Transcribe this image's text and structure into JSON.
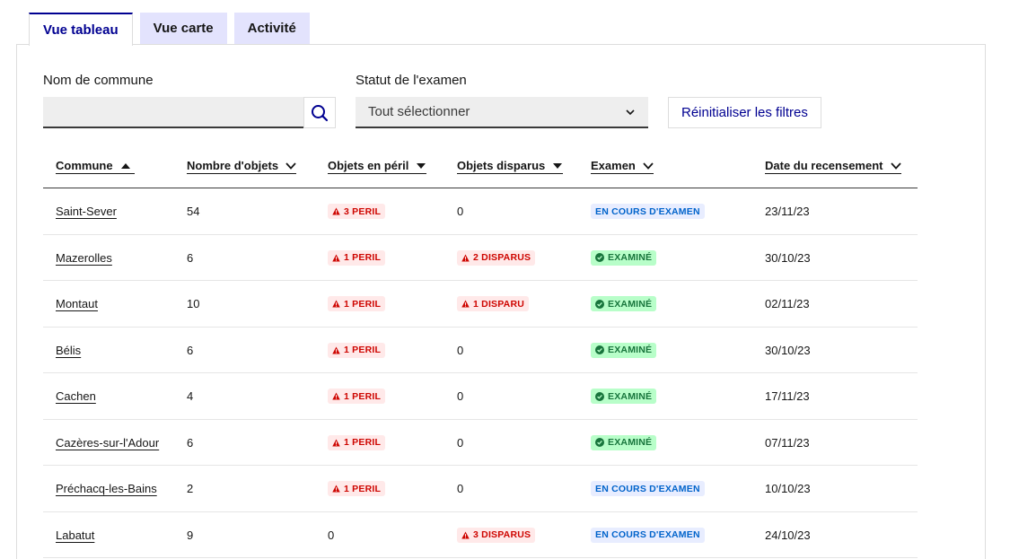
{
  "tabs": [
    {
      "label": "Vue tableau",
      "active": true
    },
    {
      "label": "Vue carte",
      "active": false
    },
    {
      "label": "Activité",
      "active": false
    }
  ],
  "filters": {
    "commune_label": "Nom de commune",
    "commune_value": "",
    "statut_label": "Statut de l'examen",
    "statut_value": "Tout sélectionner",
    "reset_label": "Réinitialiser les filtres"
  },
  "table": {
    "columns": [
      {
        "label": "Commune",
        "sort": "asc"
      },
      {
        "label": "Nombre d'objets",
        "sort": "none"
      },
      {
        "label": "Objets en péril",
        "sort": "desc"
      },
      {
        "label": "Objets disparus",
        "sort": "desc"
      },
      {
        "label": "Examen",
        "sort": "none"
      },
      {
        "label": "Date du recensement",
        "sort": "none"
      }
    ],
    "rows": [
      {
        "commune": "Saint-Sever",
        "objets": "54",
        "peril": {
          "text": "3 PERIL",
          "badge": true
        },
        "disparus": {
          "text": "0",
          "badge": false
        },
        "examen": {
          "text": "EN COURS D'EXAMEN",
          "status": "pending"
        },
        "date": "23/11/23"
      },
      {
        "commune": "Mazerolles",
        "objets": "6",
        "peril": {
          "text": "1 PERIL",
          "badge": true
        },
        "disparus": {
          "text": "2 DISPARUS",
          "badge": true
        },
        "examen": {
          "text": "EXAMINÉ",
          "status": "done"
        },
        "date": "30/10/23"
      },
      {
        "commune": "Montaut",
        "objets": "10",
        "peril": {
          "text": "1 PERIL",
          "badge": true
        },
        "disparus": {
          "text": "1 DISPARU",
          "badge": true
        },
        "examen": {
          "text": "EXAMINÉ",
          "status": "done"
        },
        "date": "02/11/23"
      },
      {
        "commune": "Bélis",
        "objets": "6",
        "peril": {
          "text": "1 PERIL",
          "badge": true
        },
        "disparus": {
          "text": "0",
          "badge": false
        },
        "examen": {
          "text": "EXAMINÉ",
          "status": "done"
        },
        "date": "30/10/23"
      },
      {
        "commune": "Cachen",
        "objets": "4",
        "peril": {
          "text": "1 PERIL",
          "badge": true
        },
        "disparus": {
          "text": "0",
          "badge": false
        },
        "examen": {
          "text": "EXAMINÉ",
          "status": "done"
        },
        "date": "17/11/23"
      },
      {
        "commune": "Cazères-sur-l'Adour",
        "objets": "6",
        "peril": {
          "text": "1 PERIL",
          "badge": true
        },
        "disparus": {
          "text": "0",
          "badge": false
        },
        "examen": {
          "text": "EXAMINÉ",
          "status": "done"
        },
        "date": "07/11/23"
      },
      {
        "commune": "Préchacq-les-Bains",
        "objets": "2",
        "peril": {
          "text": "1 PERIL",
          "badge": true
        },
        "disparus": {
          "text": "0",
          "badge": false
        },
        "examen": {
          "text": "EN COURS D'EXAMEN",
          "status": "pending"
        },
        "date": "10/10/23"
      },
      {
        "commune": "Labatut",
        "objets": "9",
        "peril": {
          "text": "0",
          "badge": false
        },
        "disparus": {
          "text": "3 DISPARUS",
          "badge": true
        },
        "examen": {
          "text": "EN COURS D'EXAMEN",
          "status": "pending"
        },
        "date": "24/10/23"
      }
    ]
  },
  "colors": {
    "accent": "#000091",
    "tab_inactive_bg": "#e3e3fd",
    "danger_bg": "#ffe9e9",
    "danger_text": "#ce0500",
    "success_bg": "#b8fec9",
    "success_text": "#18753c",
    "info_bg": "#e8edff",
    "info_text": "#0063cb"
  },
  "icons": {
    "search": "search-icon",
    "select": "chevron-down-icon",
    "peril": "warning-triangle-icon",
    "examine": "check-circle-icon"
  }
}
